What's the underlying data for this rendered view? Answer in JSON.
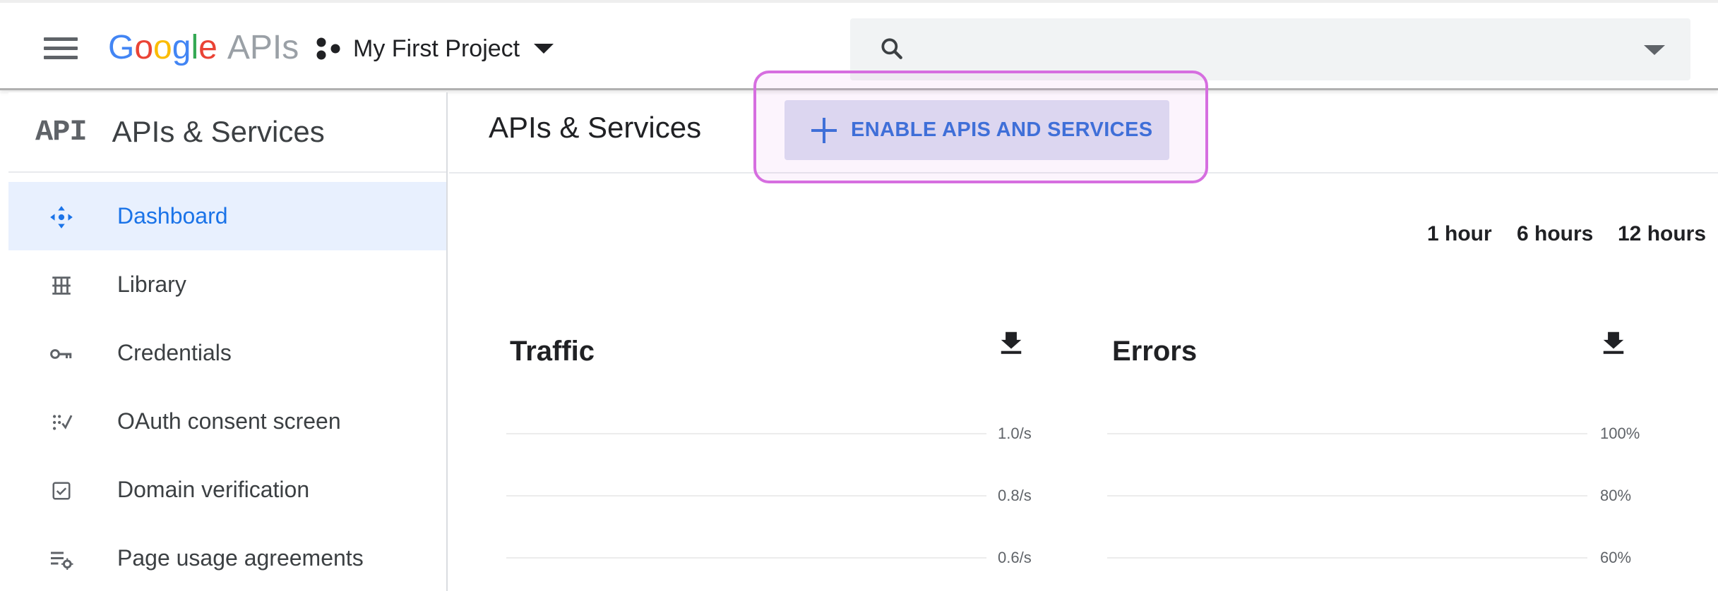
{
  "topbar": {
    "logo_google": [
      "G",
      "o",
      "o",
      "g",
      "l",
      "e"
    ],
    "logo_apis": "APIs",
    "project_name": "My First Project",
    "search_placeholder": ""
  },
  "sidebar": {
    "badge": "API",
    "title": "APIs & Services",
    "items": [
      {
        "label": "Dashboard",
        "icon": "dashboard-icon",
        "active": true
      },
      {
        "label": "Library",
        "icon": "library-icon",
        "active": false
      },
      {
        "label": "Credentials",
        "icon": "key-icon",
        "active": false
      },
      {
        "label": "OAuth consent screen",
        "icon": "consent-icon",
        "active": false
      },
      {
        "label": "Domain verification",
        "icon": "checkbox-icon",
        "active": false
      },
      {
        "label": "Page usage agreements",
        "icon": "settings-list-icon",
        "active": false
      }
    ]
  },
  "main": {
    "title": "APIs & Services",
    "enable_button": "ENABLE APIS AND SERVICES",
    "time_ranges": [
      "1 hour",
      "6 hours",
      "12 hours"
    ]
  },
  "charts": {
    "traffic": {
      "title": "Traffic",
      "ticks": [
        "1.0/s",
        "0.8/s",
        "0.6/s"
      ]
    },
    "errors": {
      "title": "Errors",
      "ticks": [
        "100%",
        "80%",
        "60%"
      ]
    }
  },
  "colors": {
    "accent": "#1a73e8",
    "active_bg": "#e8f0fe",
    "highlight": "#d66ee0",
    "button_bg": "#dcd6f0"
  }
}
